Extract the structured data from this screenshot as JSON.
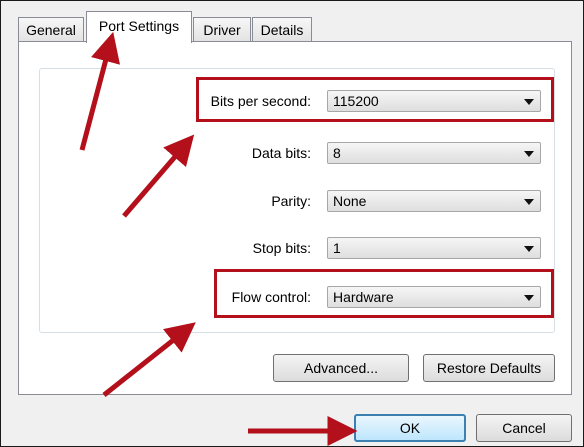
{
  "tabs": [
    {
      "label": "General"
    },
    {
      "label": "Port Settings"
    },
    {
      "label": "Driver"
    },
    {
      "label": "Details"
    }
  ],
  "active_tab": "Port Settings",
  "settings": [
    {
      "label": "Bits per second:",
      "value": "115200"
    },
    {
      "label": "Data bits:",
      "value": "8"
    },
    {
      "label": "Parity:",
      "value": "None"
    },
    {
      "label": "Stop bits:",
      "value": "1"
    },
    {
      "label": "Flow control:",
      "value": "Hardware"
    }
  ],
  "buttons": {
    "advanced": "Advanced...",
    "restore_defaults": "Restore Defaults",
    "ok": "OK",
    "cancel": "Cancel"
  },
  "colors": {
    "annotation_red": "#b3101c",
    "default_button_border": "#3c7fb1"
  },
  "icons": [
    "dropdown-arrow-icon",
    "annotation-arrow-icon"
  ]
}
